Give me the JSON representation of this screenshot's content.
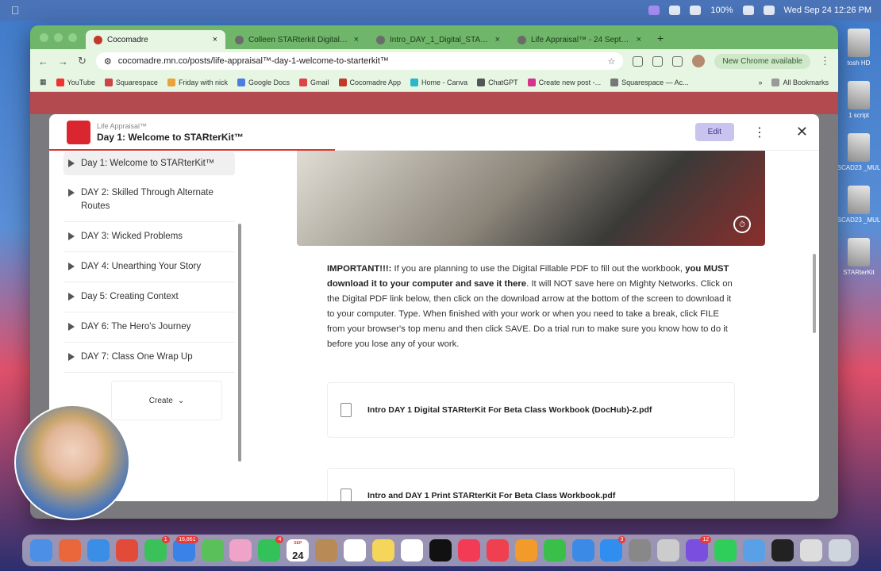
{
  "menubar": {
    "battery": "100%",
    "datetime": "Wed Sep 24  12:26 PM"
  },
  "desktop": {
    "items": [
      "tosh HD",
      "1 script",
      "SCAD23 _MUL",
      "SCAD23 _MUL",
      "STARterKit"
    ]
  },
  "browser": {
    "tabs": [
      {
        "title": "Cocomadre",
        "active": true
      },
      {
        "title": "Colleen STARterkit Digital.pdf",
        "active": false
      },
      {
        "title": "Intro_DAY_1_Digital_STARte...",
        "active": false
      },
      {
        "title": "Life Appraisal™ - 24 Septem...",
        "active": false
      }
    ],
    "url": "cocomadre.mn.co/posts/life-appraisal™-day-1-welcome-to-starterkit™",
    "new_chrome": "New Chrome available",
    "bookmarks": [
      "YouTube",
      "Squarespace",
      "Friday with nick",
      "Google Docs",
      "Gmail",
      "Cocomadre App",
      "Home - Canva",
      "ChatGPT",
      "Create new post -...",
      "Squarespace — Ac..."
    ],
    "all_bookmarks": "All Bookmarks"
  },
  "modal": {
    "subtitle": "Life Appraisal™",
    "title": "Day 1: Welcome to STARterKit™",
    "edit_label": "Edit",
    "sidebar": [
      "Day 1: Welcome to STARterKit™",
      "DAY 2: Skilled Through Alternate Routes",
      "DAY 3: Wicked Problems",
      "DAY 4: Unearthing Your Story",
      "Day 5: Creating Context",
      "DAY 6: The Hero's Journey",
      "DAY 7: Class One Wrap Up"
    ],
    "create_label": "Create",
    "body": {
      "important": "IMPORTANT!!!:",
      "p1": "  If you are planning to use the Digital Fillable PDF to fill out the workbook, ",
      "bold": "you MUST download it to your computer and save it there",
      "p2": ". It will NOT save here on Mighty Networks.  Click on the Digital PDF link below, then click on the download arrow at the bottom of the screen to download it to your computer. Type. When finished with your work or when you need to take a break, click FILE from your browser's top menu and then click SAVE.  Do a trial run to make sure you know how to do it before you lose any of your work."
    },
    "files": [
      "Intro DAY 1 Digital STARterKit For Beta Class Workbook (DocHub)-2.pdf",
      "Intro and DAY 1 Print STARterKit For Beta Class Workbook.pdf"
    ]
  },
  "dock": {
    "calendar_month": "SEP",
    "calendar_day": "24",
    "badges": {
      "messages": "1",
      "mail": "16,861",
      "facetime": "4",
      "appstore": "3",
      "canva": "12"
    }
  },
  "colors": {
    "accent": "#d9262f",
    "tabbar": "#6fb56a",
    "edit_bg": "#c8c3ef"
  }
}
